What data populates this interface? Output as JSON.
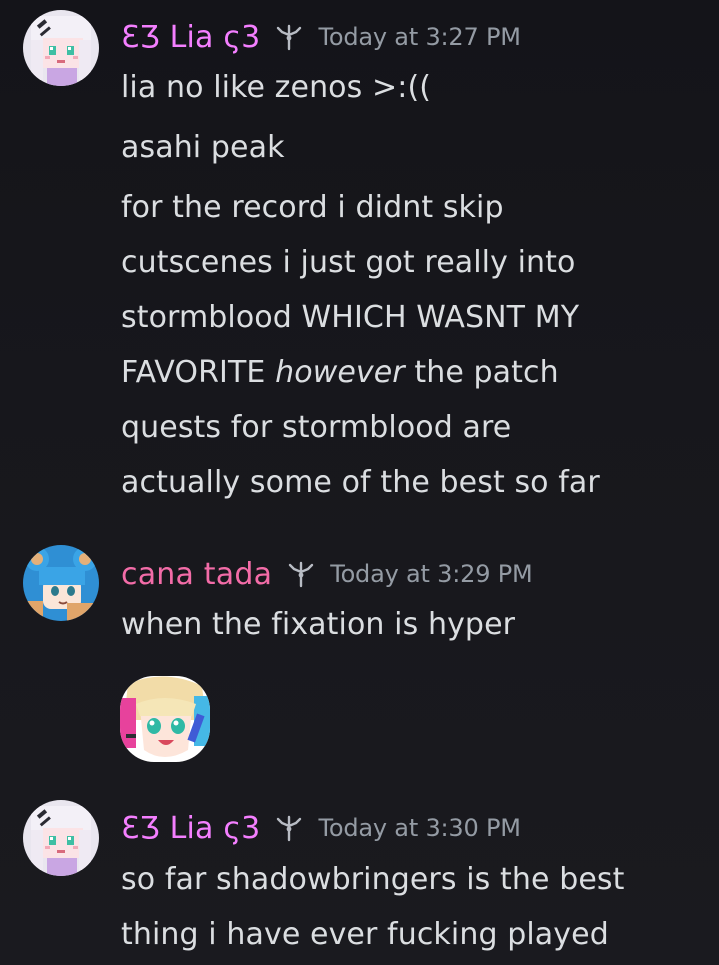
{
  "messages": [
    {
      "author": "Ƹ̵̡Ӝ̵̨̄Ʒ Lia ᶜ3",
      "author_parts": {
        "prefix": "ƐƷ",
        "name": "Lia",
        "suffix": "ς3"
      },
      "author_color": "#f47fff",
      "timestamp": "Today at 3:27 PM",
      "lines": [
        "lia no like zenos >:((",
        "asahi peak",
        "for the record i didnt skip",
        "cutscenes i just got really into",
        "stormblood WHICH WASNT MY"
      ],
      "italic_line": {
        "before": "FAVORITE ",
        "italic": "however",
        "after": " the patch"
      },
      "lines_after": [
        "quests for stormblood are",
        "actually some of the best so far"
      ]
    },
    {
      "author": "cana tada",
      "author_color": "#f36ca8",
      "timestamp": "Today at 3:29 PM",
      "lines": [
        "when the fixation is hyper"
      ]
    },
    {
      "author_parts": {
        "prefix": "ƐƷ",
        "name": "Lia",
        "suffix": "ς3"
      },
      "author_color": "#f47fff",
      "timestamp": "Today at 3:30 PM",
      "lines": [
        "so far shadowbringers is the best",
        "thing i have ever fucking played"
      ]
    }
  ],
  "icons": {
    "badge": "role-badge-icon",
    "sticker": "anime-girl-sticker"
  },
  "colors": {
    "background": "#17171c",
    "text": "#dbdee1",
    "timestamp": "#949ba4",
    "lia": "#f47fff",
    "cana": "#f36ca8"
  }
}
